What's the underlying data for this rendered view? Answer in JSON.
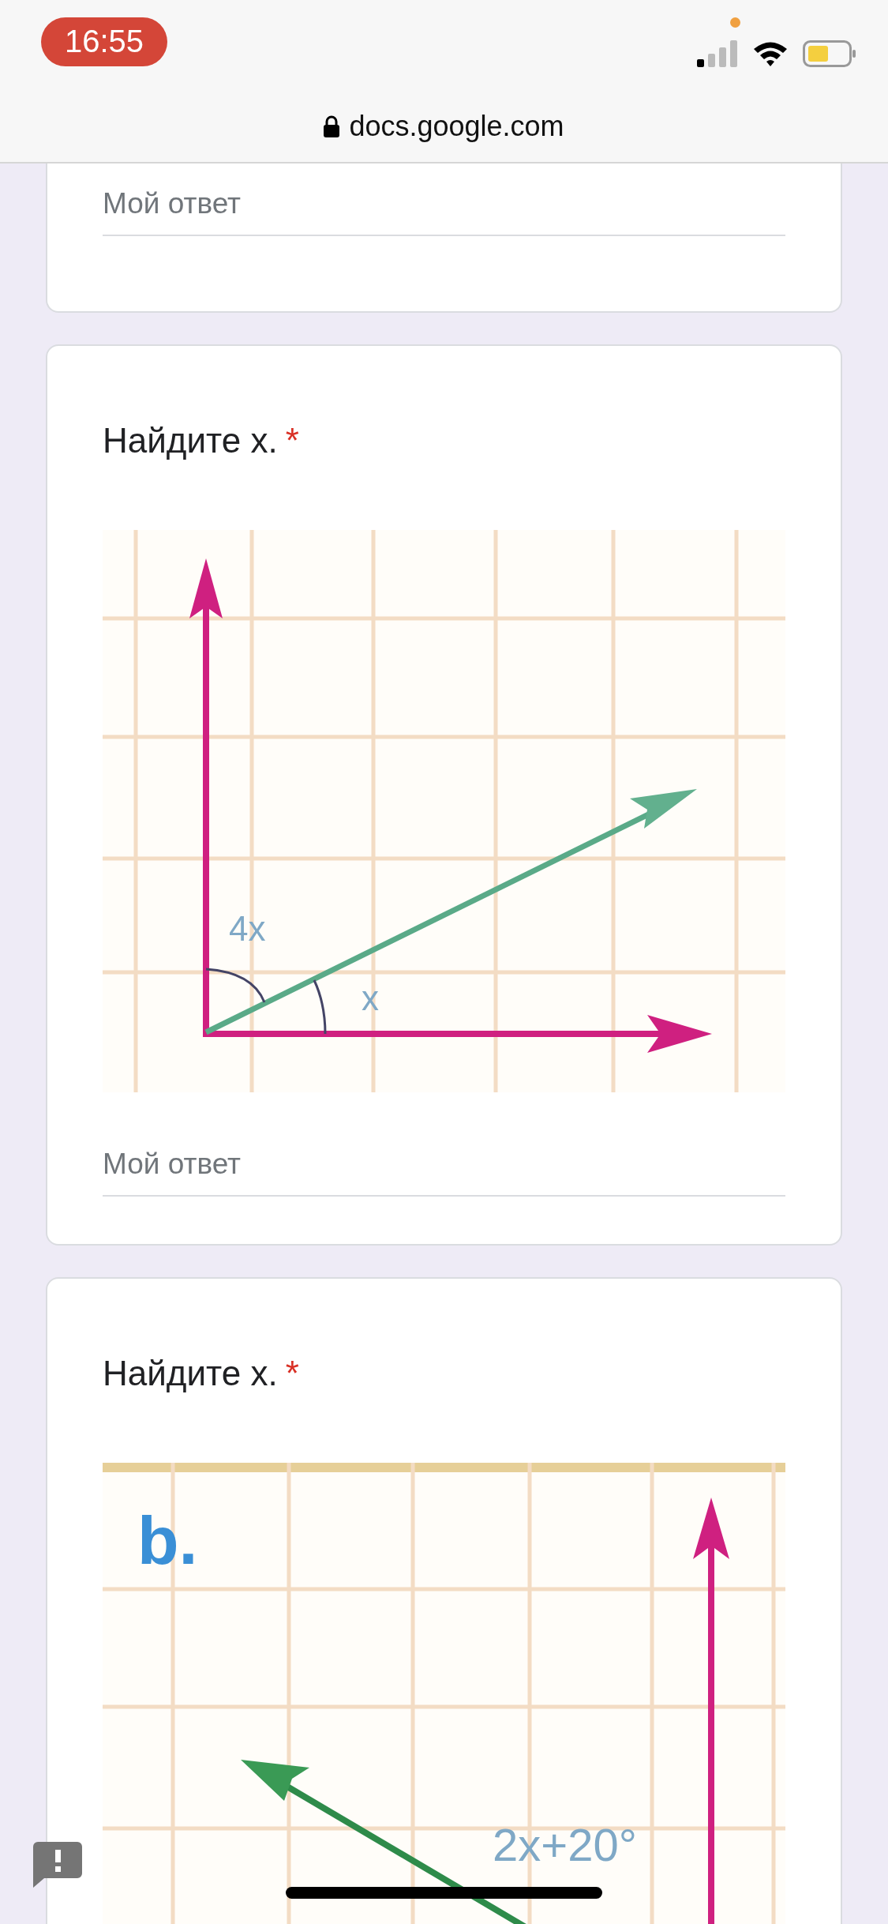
{
  "status_bar": {
    "time": "16:55"
  },
  "address_bar": {
    "url": "docs.google.com"
  },
  "questions": [
    {
      "answer_placeholder": "Мой ответ"
    },
    {
      "title": "Найдите x.",
      "required": true,
      "required_mark": "*",
      "diagram": {
        "kind": "angle_a",
        "labels": [
          "4x",
          "x"
        ]
      },
      "answer_placeholder": "Мой ответ"
    },
    {
      "title": "Найдите x.",
      "required": true,
      "required_mark": "*",
      "diagram": {
        "kind": "angle_b",
        "labels": [
          "b.",
          "2x+20°"
        ]
      }
    }
  ]
}
